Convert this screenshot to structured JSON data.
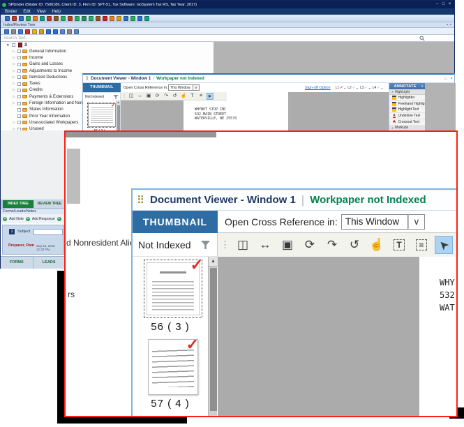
{
  "colors": {
    "accent_blue": "#2E6DA4",
    "status_green": "#00834C",
    "check_red": "#D93025",
    "overlay_border": "#FF1E14",
    "title_navy": "#1F3864",
    "selected_tool_bg": "#ADD3F2",
    "index_tab_green": "#188038"
  },
  "main_window": {
    "title": "SPbinder (Binder ID: 7500186, Client ID: 3, Firm ID: SPT-51, Tax Software: GoSystem Tax RS, Tax Year: 2017)",
    "window_controls": [
      "–",
      "□",
      "×"
    ],
    "menu": [
      "Binder",
      "Edit",
      "View",
      "Help"
    ],
    "toolbar1_icon_colors": [
      "#2f6fc4",
      "#c0392b",
      "#2f6fc4",
      "#27ae60",
      "#e67e22",
      "#16a085",
      "#c0392b",
      "#8e5a2b",
      "#27ae60",
      "#c0392b",
      "#27ae60",
      "#2e8b57",
      "#27ae60",
      "#a0522d",
      "#cc2222",
      "#e67e22",
      "#d4a017",
      "#2f6fc4",
      "#27ae60",
      "#2f6fc4",
      "#16a085"
    ],
    "tree_panel_header": "Index/Review Tree",
    "toolbar2_icon_colors": [
      "#3a7bd5",
      "#8a8a8a",
      "#3a7bd5",
      "#c0392b",
      "#e6b422",
      "#d4a017",
      "#2f6fc4",
      "#2f6fc4",
      "#5588cc",
      "#8a8a8a",
      "#5588cc"
    ],
    "search_placeholder": "Search Text...",
    "tree": {
      "root_label": "3",
      "items": [
        {
          "label": "General Information",
          "expandable": true
        },
        {
          "label": "Income",
          "expandable": true
        },
        {
          "label": "Gains and Losses",
          "expandable": true
        },
        {
          "label": "Adjustments to Income",
          "expandable": true
        },
        {
          "label": "Itemized Deductions",
          "expandable": true
        },
        {
          "label": "Taxes",
          "expandable": true
        },
        {
          "label": "Credits",
          "expandable": true
        },
        {
          "label": "Payments & Extensions",
          "expandable": true
        },
        {
          "label": "Foreign Information and Nonresident Alie",
          "expandable": true
        },
        {
          "label": "States Information",
          "expandable": false
        },
        {
          "label": "Prior Year Information",
          "expandable": false
        },
        {
          "label": "Unassociated Workpapers",
          "expandable": true
        },
        {
          "label": "Unused",
          "expandable": true
        }
      ]
    },
    "left_tabs": {
      "index": "INDEX TREE",
      "review": "REVIEW TREE"
    },
    "notes_panel": {
      "header": "Forms/Leads/Notes",
      "add_note": "Add Note",
      "add_response": "Add Response",
      "note_number": "1",
      "subject_label": "Subject",
      "author": "Preparer, Pam",
      "timestamp": "Sep 16, 2018 12:33 PM",
      "bottom_tabs": [
        "FORMS",
        "LEADS"
      ]
    }
  },
  "doc_viewer_small": {
    "title": "Document Viewer - Window 1",
    "status": "Workpaper not Indexed",
    "window_controls": [
      "□",
      "×"
    ],
    "thumbnail_tab": "THUMBNAIL",
    "cross_ref_label": "Open Cross Reference in:",
    "cross_ref_value": "This Window",
    "signoff": {
      "link": "Sign-off Option",
      "levels": [
        {
          "label": "L1",
          "state": "checked-red"
        },
        {
          "label": "L2",
          "state": "checked-gray"
        },
        {
          "label": "L3",
          "state": "checked-gray"
        },
        {
          "label": "L4",
          "state": "checked-gray"
        }
      ]
    },
    "filter_label": "Not Indexed",
    "page_caption": "56 ( 3 )",
    "document_lines": [
      "WHYNOT STOP INC",
      "532 MAIN STREET",
      "WATERVILLE, NE 25570"
    ],
    "annotate": {
      "header": "ANNOTATE",
      "sections": [
        {
          "label": "HighLight",
          "items": [
            {
              "label": "Highlighter",
              "icon": "pen"
            },
            {
              "label": "Freehand Highlighter",
              "icon": "pen"
            },
            {
              "label": "Highlight Text",
              "icon": "pen"
            },
            {
              "label": "Underline Text",
              "icon": "letter-underline"
            },
            {
              "label": "Crossout Text",
              "icon": "letter-strike"
            }
          ]
        },
        {
          "label": "Markups",
          "items": []
        }
      ]
    }
  },
  "doc_viewer_zoom": {
    "title": "Document Viewer - Window 1",
    "status": "Workpaper not Indexed",
    "thumbnail_tab": "THUMBNAIL",
    "cross_ref_label": "Open Cross Reference in:",
    "cross_ref_value": "This Window",
    "filter_label": "Not Indexed",
    "toolbar": [
      {
        "name": "open-document-icon",
        "glyph": "◫"
      },
      {
        "name": "fit-width-icon",
        "glyph": "↔"
      },
      {
        "name": "fit-page-icon",
        "glyph": "▣"
      },
      {
        "name": "rotate-clockwise-icon",
        "glyph": "⟳"
      },
      {
        "name": "rotate-180-icon",
        "glyph": "↷"
      },
      {
        "name": "rotate-counterclockwise-icon",
        "glyph": "↺"
      },
      {
        "name": "pan-hand-icon",
        "glyph": "☝"
      },
      {
        "name": "select-text-icon",
        "glyph": "T",
        "boxed": true
      },
      {
        "name": "select-lines-icon",
        "glyph": "≡",
        "boxed": true
      },
      {
        "name": "pointer-select-icon",
        "glyph": "➤",
        "rotate": true,
        "selected": true
      }
    ],
    "thumbnails": [
      {
        "caption": "56 ( 3 )",
        "checked": true,
        "selected": true
      },
      {
        "caption": "57 ( 4 )",
        "checked": true,
        "selected": false
      }
    ],
    "page_fragment_lines": [
      "WHY",
      "532",
      "WAT"
    ],
    "left_fragments": [
      "d Nonresident Alie",
      "rs"
    ]
  }
}
